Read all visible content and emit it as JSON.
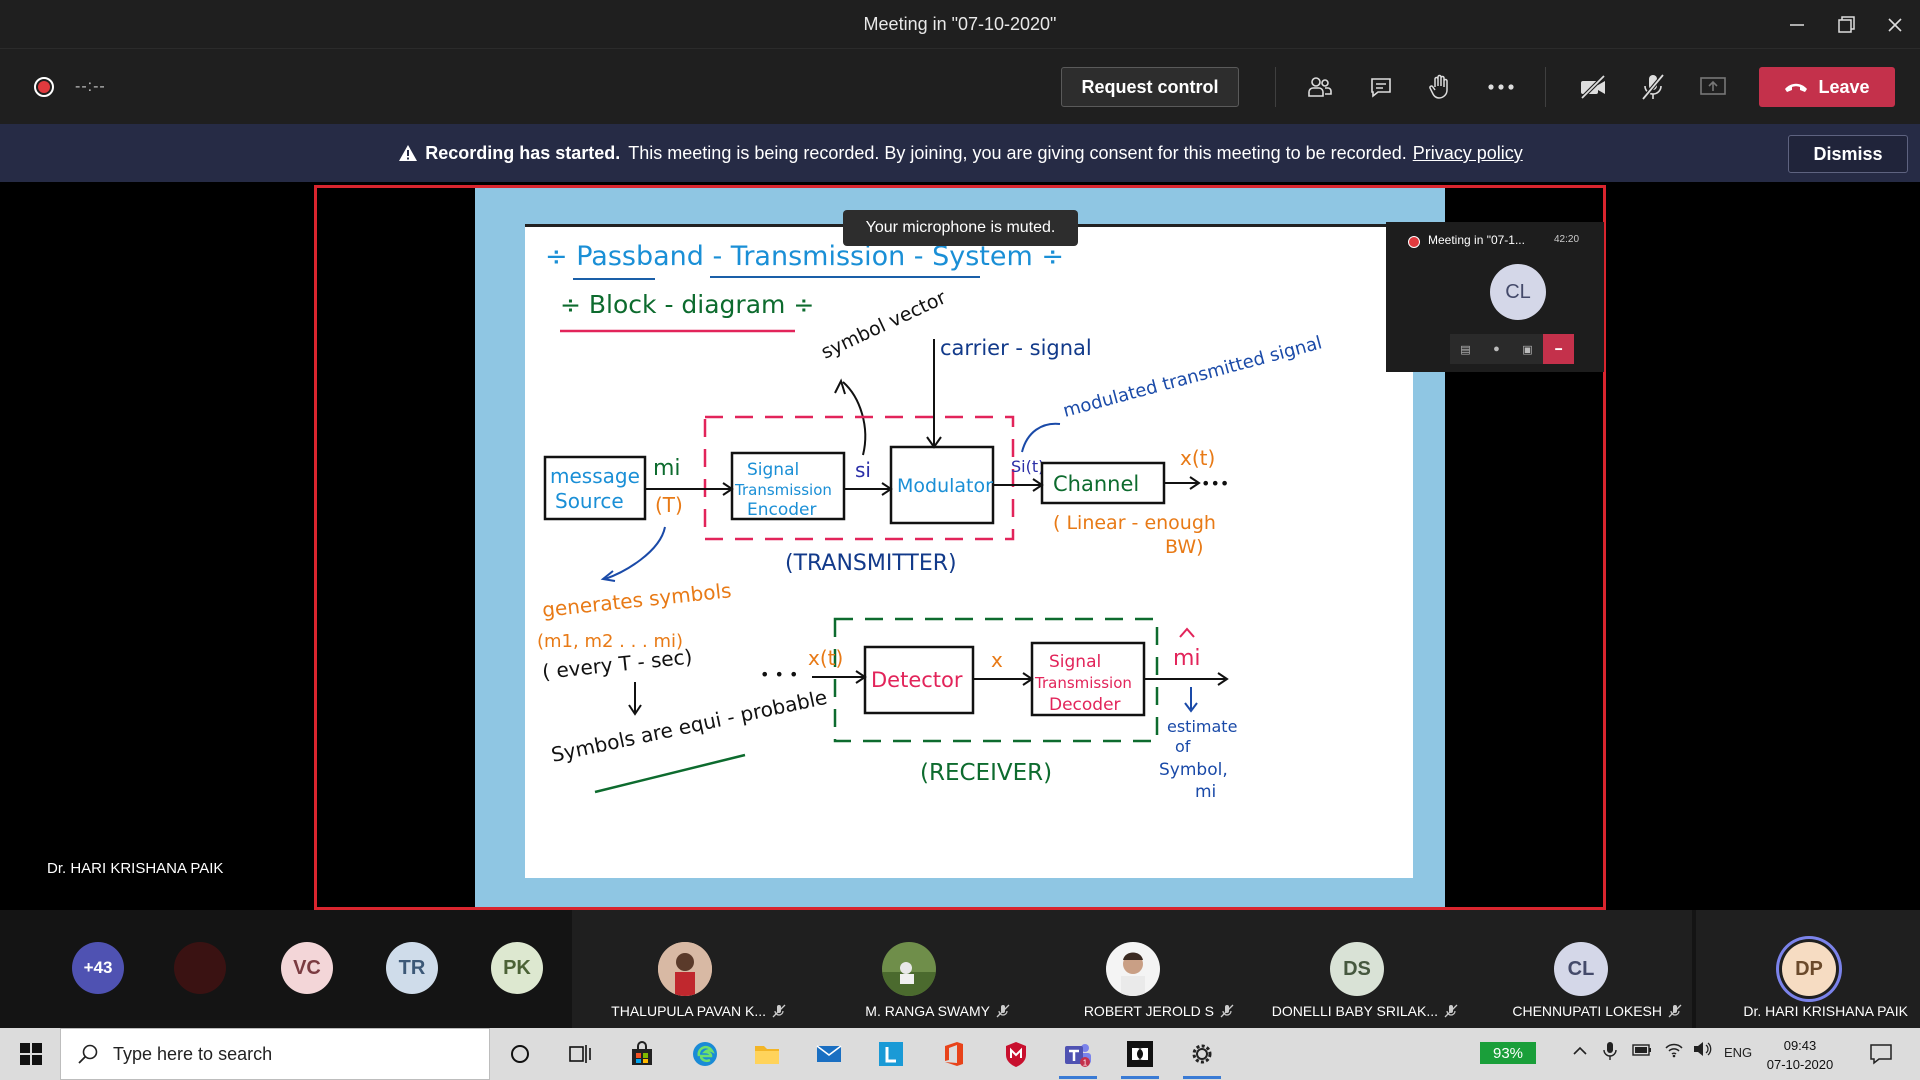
{
  "window": {
    "title": "Meeting in \"07-10-2020\""
  },
  "toolbar": {
    "timer": "--:--",
    "request_control": "Request control",
    "leave": "Leave"
  },
  "banner": {
    "bold": "Recording has started.",
    "text": "This meeting is being recorded. By joining, you are giving consent for this meeting to be recorded.",
    "link": "Privacy policy",
    "dismiss": "Dismiss"
  },
  "stage": {
    "presenter_name": "Dr. HARI KRISHANA PAIK",
    "toast": "Your microphone is muted.",
    "minicall": {
      "title": "Meeting in \"07-1...",
      "time": "42:20",
      "initials": "CL"
    }
  },
  "slide": {
    "title": "÷ Passband - Transmission - System ÷",
    "subtitle": "÷ Block - diagram ÷",
    "symbol_vector": "symbol vector",
    "carrier": "carrier - signal",
    "modulated": "modulated transmitted signal",
    "message_source": [
      "message",
      "Source"
    ],
    "mi": "mi",
    "T": "(T)",
    "encoder": [
      "Signal",
      "Transmission",
      "Encoder"
    ],
    "si": "si",
    "modulator": "Modulator",
    "sit": "Si(t)",
    "channel": "Channel",
    "xt": "x(t)",
    "dots": "•••",
    "linear": "( Linear - enough",
    "bw": "BW)",
    "transmitter": "(TRANSMITTER)",
    "generates": "generates symbols",
    "m_list": "(m1, m2 . . . mi)",
    "every": "( every  T - sec)",
    "equi": "Symbols are equi - probable",
    "rx_dots": "• • •",
    "rx_xt": "x(t)",
    "detector": "Detector",
    "x": "x",
    "decoder": [
      "Signal",
      "Transmission",
      "Decoder"
    ],
    "mi_hat": "mi",
    "receiver": "(RECEIVER)",
    "estimate": [
      "estimate",
      "of",
      "Symbol,",
      "mi"
    ]
  },
  "participants": {
    "overflow": "+43",
    "circles": [
      {
        "initials": "VC",
        "bg": "#f3d6d8",
        "fg": "#7a3b41"
      },
      {
        "initials": "TR",
        "bg": "#cfdcea",
        "fg": "#3c5877"
      },
      {
        "initials": "PK",
        "bg": "#dde8d0",
        "fg": "#4b6236"
      }
    ],
    "tiles": [
      {
        "name": "THALUPULA PAVAN K...",
        "initials": "",
        "photo": "person-photo"
      },
      {
        "name": "M. RANGA SWAMY",
        "initials": "",
        "photo": "outdoor-photo"
      },
      {
        "name": "ROBERT JEROLD S",
        "initials": "",
        "photo": "portrait-photo"
      },
      {
        "name": "DONELLI BABY SRILAK...",
        "initials": "DS"
      },
      {
        "name": "CHENNUPATI LOKESH",
        "initials": "CL"
      },
      {
        "name": "Dr. HARI KRISHANA PAIK",
        "initials": "DP"
      }
    ]
  },
  "taskbar": {
    "search_placeholder": "Type here to search",
    "battery": "93%",
    "lang": "ENG",
    "time": "09:43",
    "date": "07-10-2020"
  },
  "colors": {
    "leave": "#c4314b",
    "banner": "#262b45",
    "share_border": "#d9252e",
    "accent": "#7b83eb"
  }
}
